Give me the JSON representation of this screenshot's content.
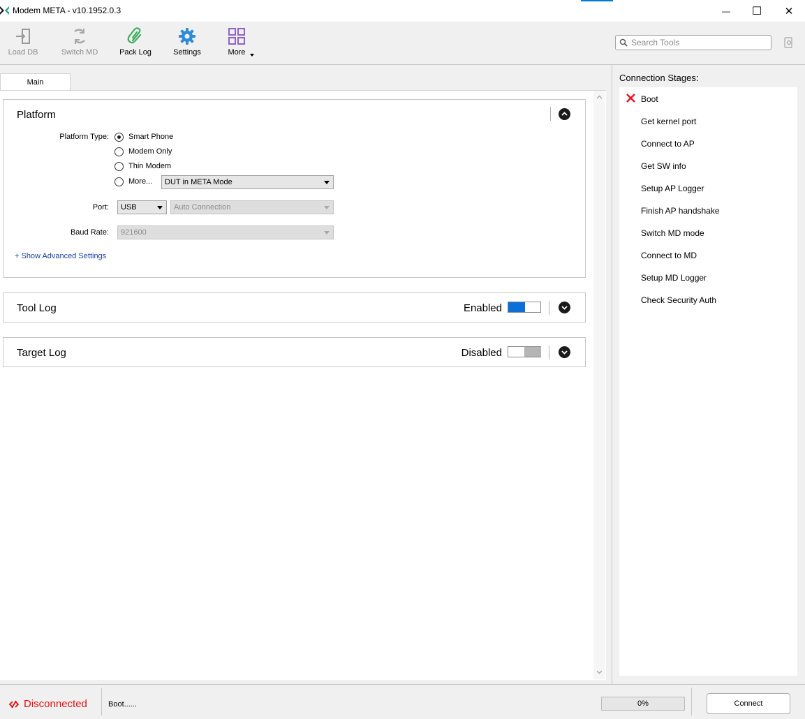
{
  "window": {
    "title": "Modem META - v10.1952.0.3",
    "minimize_glyph": "—",
    "maximize_glyph": "☐",
    "close_glyph": "✕"
  },
  "toolbar": {
    "items": [
      {
        "label": "Load DB",
        "icon": "load-db-icon",
        "enabled": false
      },
      {
        "label": "Switch MD",
        "icon": "switch-md-icon",
        "enabled": false
      },
      {
        "label": "Pack Log",
        "icon": "paperclip-icon",
        "enabled": true
      },
      {
        "label": "Settings",
        "icon": "gear-icon",
        "enabled": true
      },
      {
        "label": "More",
        "icon": "grid-icon",
        "enabled": true
      }
    ],
    "search_placeholder": "Search Tools"
  },
  "tabs": [
    {
      "label": "Main",
      "active": true
    }
  ],
  "platform": {
    "title": "Platform",
    "platform_type_label": "Platform Type:",
    "options": [
      "Smart Phone",
      "Modem Only",
      "Thin Modem",
      "More..."
    ],
    "selected": "Smart Phone",
    "more_select_value": "DUT in META Mode",
    "port_label": "Port:",
    "port_value": "USB",
    "connection_value": "Auto Connection",
    "baud_label": "Baud Rate:",
    "baud_value": "921600",
    "advanced_link": "+ Show Advanced Settings"
  },
  "tool_log": {
    "title": "Tool Log",
    "state": "Enabled",
    "enabled": true
  },
  "target_log": {
    "title": "Target Log",
    "state": "Disabled",
    "enabled": false
  },
  "connection_stages": {
    "title": "Connection Stages:",
    "stages": [
      {
        "label": "Boot",
        "status": "failed"
      },
      {
        "label": "Get kernel port",
        "status": "pending"
      },
      {
        "label": "Connect to AP",
        "status": "pending"
      },
      {
        "label": "Get SW info",
        "status": "pending"
      },
      {
        "label": "Setup AP Logger",
        "status": "pending"
      },
      {
        "label": "Finish AP handshake",
        "status": "pending"
      },
      {
        "label": "Switch MD mode",
        "status": "pending"
      },
      {
        "label": "Connect to MD",
        "status": "pending"
      },
      {
        "label": "Setup MD Logger",
        "status": "pending"
      },
      {
        "label": "Check Security Auth",
        "status": "pending"
      }
    ]
  },
  "status": {
    "connection": "Disconnected",
    "message": "Boot......",
    "progress_text": "0%",
    "progress_value": 0,
    "connect_label": "Connect"
  },
  "colors": {
    "accent": "#0a6fd6",
    "error": "#e01010",
    "link": "#1a3ea0"
  }
}
